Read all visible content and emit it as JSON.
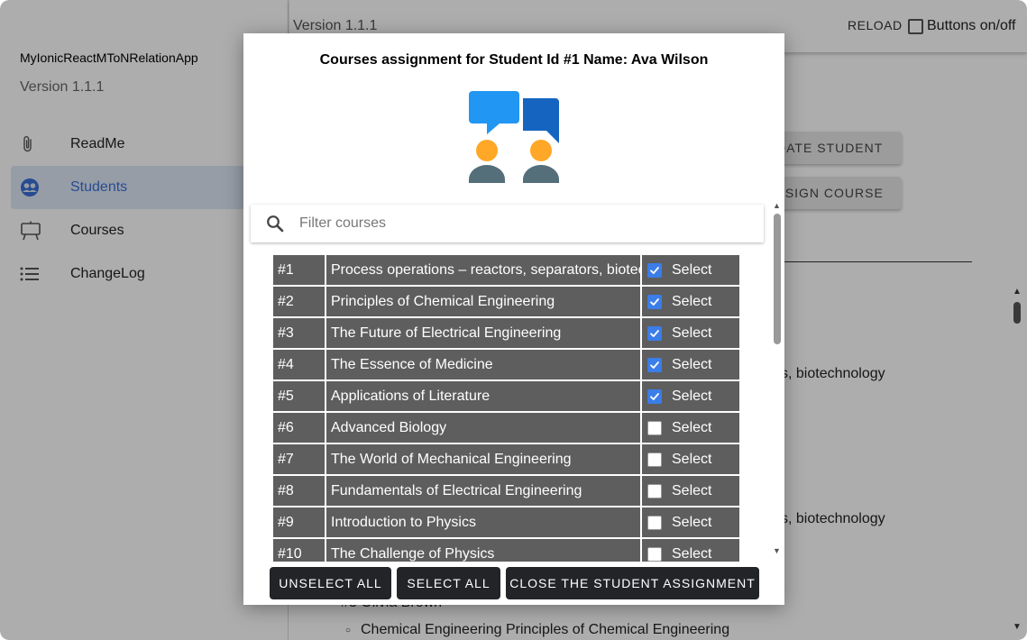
{
  "sidebar": {
    "app_title": "MyIonicReactMToNRelationApp",
    "version": "Version 1.1.1",
    "items": [
      {
        "label": "ReadMe",
        "icon": "paperclip-icon"
      },
      {
        "label": "Students",
        "icon": "people-circle-icon",
        "active": true
      },
      {
        "label": "Courses",
        "icon": "easel-icon"
      },
      {
        "label": "ChangeLog",
        "icon": "list-icon"
      }
    ]
  },
  "header": {
    "version": "Version 1.1.1",
    "reload_label": "RELOAD",
    "toggle_label": "Buttons on/off"
  },
  "content": {
    "update_button": "PDATE STUDENT",
    "assign_button": "ASSIGN COURSE",
    "text_1": "s, biotechnology",
    "text_2": "s, biotechnology",
    "student_heading": "#3 Olivia Brown",
    "course_item": "Chemical Engineering Principles of Chemical Engineering"
  },
  "modal": {
    "title": "Courses assignment for Student Id #1 Name: Ava Wilson",
    "filter_placeholder": "Filter courses",
    "select_label": "Select",
    "courses": [
      {
        "id": "#1",
        "name": "Process operations – reactors, separators, biotechnology",
        "selected": true
      },
      {
        "id": "#2",
        "name": "Principles of Chemical Engineering",
        "selected": true
      },
      {
        "id": "#3",
        "name": "The Future of Electrical Engineering",
        "selected": true
      },
      {
        "id": "#4",
        "name": "The Essence of Medicine",
        "selected": true
      },
      {
        "id": "#5",
        "name": "Applications of Literature",
        "selected": true
      },
      {
        "id": "#6",
        "name": "Advanced Biology",
        "selected": false
      },
      {
        "id": "#7",
        "name": "The World of Mechanical Engineering",
        "selected": false
      },
      {
        "id": "#8",
        "name": "Fundamentals of Electrical Engineering",
        "selected": false
      },
      {
        "id": "#9",
        "name": "Introduction to Physics",
        "selected": false
      },
      {
        "id": "#10",
        "name": "The Challenge of Physics",
        "selected": false
      }
    ],
    "buttons": {
      "unselect_all": "UNSELECT ALL",
      "select_all": "SELECT ALL",
      "close": "CLOSE THE STUDENT ASSIGNMENT"
    }
  },
  "colors": {
    "accent": "#3b7de9",
    "row_bg": "#5e5e5e",
    "button_dark": "#222428",
    "nav_active_bg": "#dde7f7"
  }
}
